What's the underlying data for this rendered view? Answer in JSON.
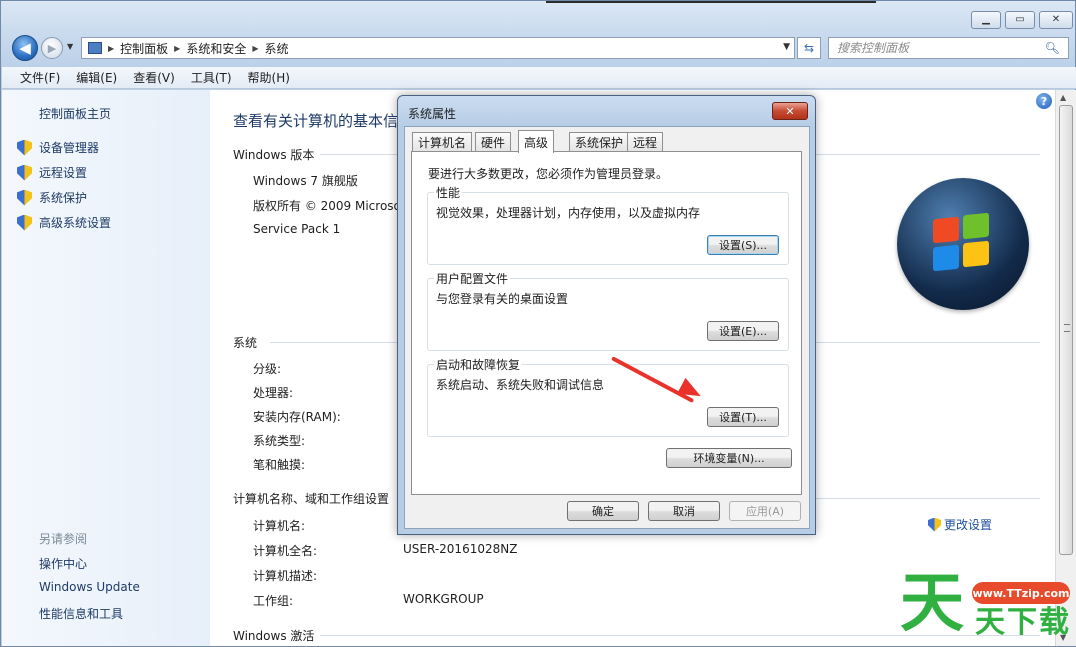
{
  "window": {
    "caption": {
      "minimize": "▁",
      "maximize": "▭",
      "close": "✕"
    }
  },
  "nav": {
    "breadcrumbs": [
      "控制面板",
      "系统和安全",
      "系统"
    ],
    "search_placeholder": "搜索控制面板"
  },
  "menu": [
    "文件(F)",
    "编辑(E)",
    "查看(V)",
    "工具(T)",
    "帮助(H)"
  ],
  "sidebar": {
    "home": "控制面板主页",
    "links": [
      "设备管理器",
      "远程设置",
      "系统保护",
      "高级系统设置"
    ],
    "see_also_title": "另请参阅",
    "see_also": [
      "操作中心",
      "Windows Update",
      "性能信息和工具"
    ]
  },
  "main": {
    "title": "查看有关计算机的基本信息",
    "windows_edition": {
      "heading": "Windows 版本",
      "edition": "Windows 7 旗舰版",
      "copyright": "版权所有 © 2009 Microsoft Corporation",
      "service_pack": "Service Pack 1"
    },
    "system": {
      "heading": "系统",
      "fields": [
        "分级:",
        "处理器:",
        "安装内存(RAM):",
        "系统类型:",
        "笔和触摸:"
      ]
    },
    "computer": {
      "heading": "计算机名称、域和工作组设置",
      "fields": [
        {
          "label": "计算机名:",
          "value": ""
        },
        {
          "label": "计算机全名:",
          "value": "USER-20161028NZ"
        },
        {
          "label": "计算机描述:",
          "value": ""
        },
        {
          "label": "工作组:",
          "value": "WORKGROUP"
        }
      ],
      "change_settings": "更改设置"
    },
    "activation_heading": "Windows 激活"
  },
  "dialog": {
    "title": "系统属性",
    "tabs": [
      "计算机名",
      "硬件",
      "高级",
      "系统保护",
      "远程"
    ],
    "active_tab": "高级",
    "admin_note": "要进行大多数更改，您必须作为管理员登录。",
    "groups": [
      {
        "label": "性能",
        "desc": "视觉效果，处理器计划，内存使用，以及虚拟内存",
        "button": "设置(S)..."
      },
      {
        "label": "用户配置文件",
        "desc": "与您登录有关的桌面设置",
        "button": "设置(E)..."
      },
      {
        "label": "启动和故障恢复",
        "desc": "系统启动、系统失败和调试信息",
        "button": "设置(T)..."
      }
    ],
    "env_button": "环境变量(N)...",
    "ok": "确定",
    "cancel": "取消",
    "apply": "应用(A)"
  },
  "watermark": {
    "url": "www.TTzip.com",
    "big": "天",
    "small": "天下载"
  },
  "colors": {
    "arrow": "#e8322a",
    "watermark_green": "#2fb040",
    "watermark_badge": "#e84b2c"
  }
}
